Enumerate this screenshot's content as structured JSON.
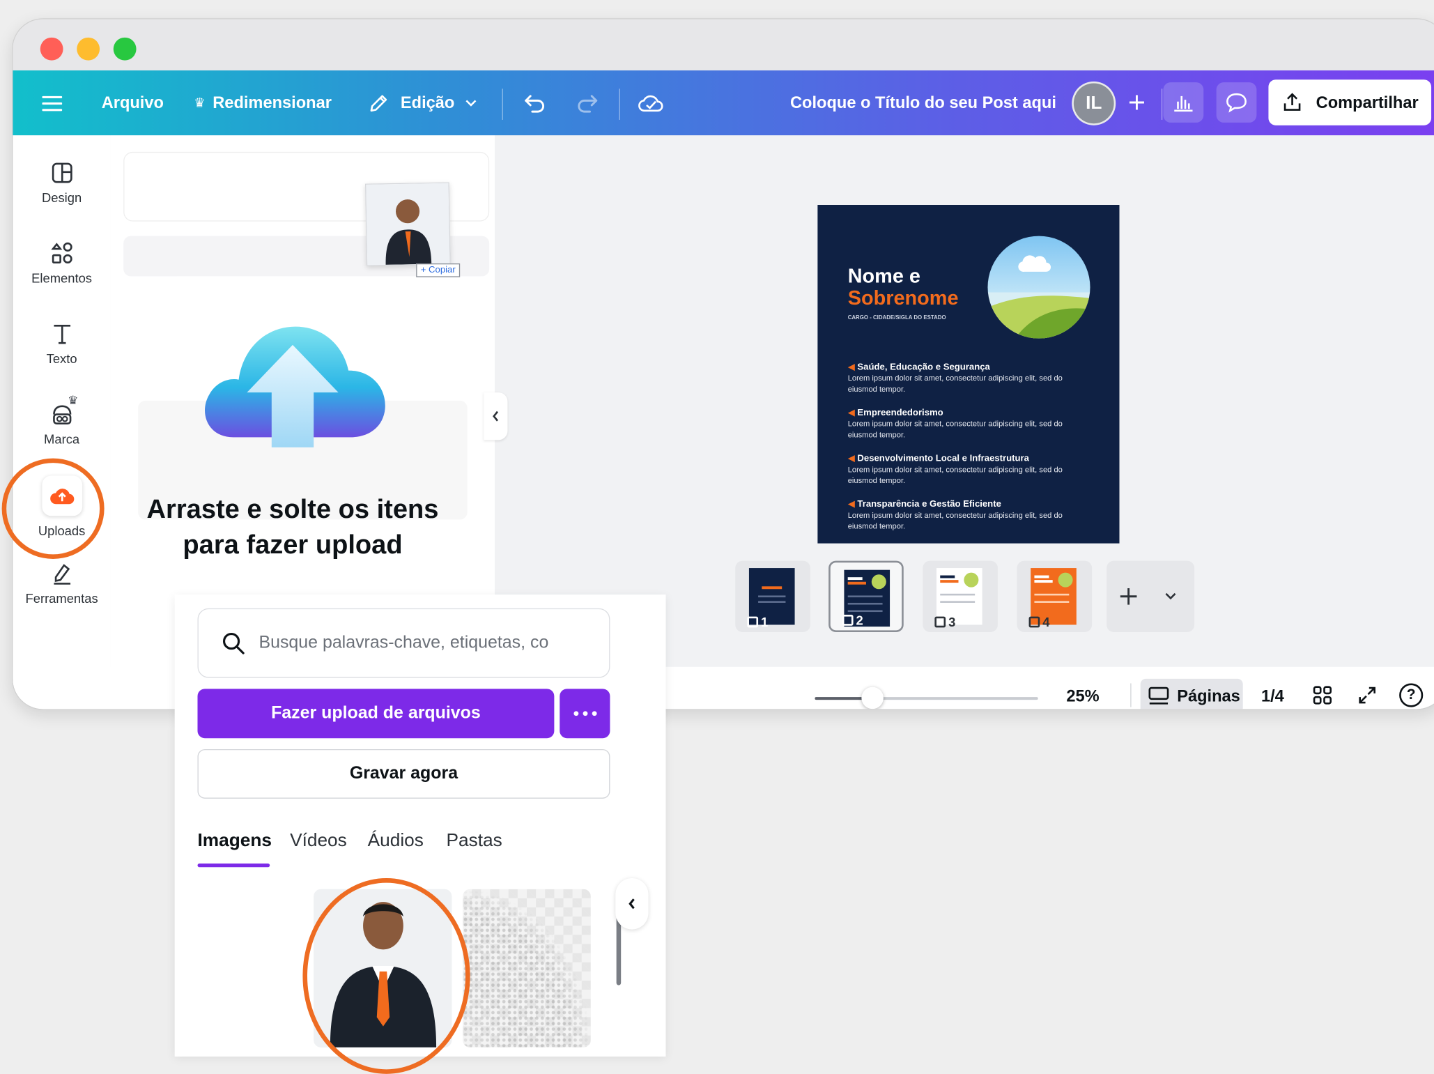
{
  "window": {
    "traffic_lights": {
      "close": "#ff5f57",
      "minimize": "#febc2e",
      "maximize": "#28c840"
    }
  },
  "toolbar": {
    "menu_icon": "hamburger-icon",
    "file_label": "Arquivo",
    "resize_label": "Redimensionar",
    "edit_label": "Edição",
    "title": "Coloque o Título do seu Post aqui",
    "avatar_initials": "IL",
    "share_label": "Compartilhar"
  },
  "sidebar": {
    "items": [
      {
        "label": "Design",
        "icon": "layout-icon"
      },
      {
        "label": "Elementos",
        "icon": "shapes-icon"
      },
      {
        "label": "Texto",
        "icon": "text-icon"
      },
      {
        "label": "Marca",
        "icon": "brand-icon"
      },
      {
        "label": "Uploads",
        "icon": "cloud-upload-icon"
      },
      {
        "label": "Ferramentas",
        "icon": "tools-icon"
      }
    ]
  },
  "dropzone": {
    "line1": "Arraste e solte os itens",
    "line2": "para fazer upload",
    "copy_badge": "+ Copiar"
  },
  "poster": {
    "name_line1": "Nome e",
    "name_line2": "Sobrenome",
    "subtitle": "CARGO - CIDADE/SIGLA DO ESTADO",
    "bullets": [
      {
        "title": "Saúde, Educação e Segurança",
        "body": "Lorem ipsum dolor sit amet, consectetur adipiscing elit, sed do eiusmod tempor."
      },
      {
        "title": "Empreendedorismo",
        "body": "Lorem ipsum dolor sit amet, consectetur adipiscing elit, sed do eiusmod tempor."
      },
      {
        "title": "Desenvolvimento Local e Infraestrutura",
        "body": "Lorem ipsum dolor sit amet, consectetur adipiscing elit, sed do eiusmod tempor."
      },
      {
        "title": "Transparência e Gestão Eficiente",
        "body": "Lorem ipsum dolor sit amet, consectetur adipiscing elit, sed do eiusmod tempor."
      }
    ],
    "colors": {
      "background": "#0f2144",
      "accent": "#f26b1d"
    }
  },
  "pages": {
    "thumbnails": [
      {
        "number": "1"
      },
      {
        "number": "2"
      },
      {
        "number": "3"
      },
      {
        "number": "4"
      }
    ]
  },
  "footer": {
    "zoom_percent": 25,
    "zoom_label": "25%",
    "pages_label": "Páginas",
    "page_counter": "1/4"
  },
  "upload_panel": {
    "search_placeholder": "Busque palavras-chave, etiquetas, co",
    "upload_button": "Fazer upload de arquivos",
    "record_button": "Gravar agora",
    "tabs": [
      {
        "label": "Imagens",
        "active": true
      },
      {
        "label": "Vídeos"
      },
      {
        "label": "Áudios"
      },
      {
        "label": "Pastas"
      }
    ],
    "accent_color": "#7d2ae8"
  },
  "highlight_color": "#ee6c22"
}
